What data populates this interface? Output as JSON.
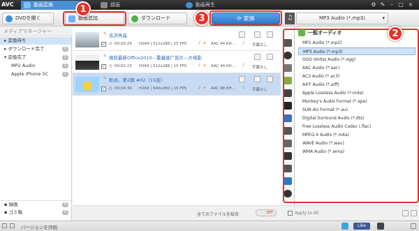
{
  "app": {
    "logo": "AVC"
  },
  "tabs": [
    {
      "label": "動画変換"
    },
    {
      "label": "録画"
    },
    {
      "label": "動画再生"
    }
  ],
  "toolbar": {
    "dvd_label": "DVDを開く",
    "add_video_label": "動画追加",
    "download_label": "ダウンロード",
    "convert_label": "変換",
    "format_select": "MP3 Audio (*.mp3)"
  },
  "badges": {
    "one": "1",
    "two": "2",
    "three": "3"
  },
  "sidebar": {
    "header": "メディアマネージャー",
    "items": [
      {
        "label": "変換待ち",
        "count": ""
      },
      {
        "label": "ダウンロード完了",
        "count": "0"
      },
      {
        "label": "変換完了",
        "count": "2"
      },
      {
        "label": "MP2 Audio",
        "count": "1"
      },
      {
        "label": "Apple iPhone 5C",
        "count": "1"
      }
    ],
    "bottom_items": [
      {
        "label": "録画",
        "count": "0"
      },
      {
        "label": "ゴミ箱",
        "count": "0"
      }
    ]
  },
  "files": [
    {
      "name": "吉沢亮晶",
      "duration": "00:00:29",
      "video": "H264 | 512x288 | 15 FPS",
      "audio": "AAC 44 KH...",
      "subtitle": "字幕なし"
    },
    {
      "name": "微软最新Office2010—重量级广告片—大电影",
      "duration": "00:02:15",
      "video": "H264 | 512x288 | 15 FPS",
      "audio": "AAC 44 KH...",
      "subtitle": "字幕なし"
    },
    {
      "name": "乾貞。第2期 #02（15話）",
      "duration": "00:04:30",
      "video": "H264 | 640x360 | 15 FPS",
      "audio": "AAC 48 KH...",
      "subtitle": "字幕なし"
    }
  ],
  "list_footer": {
    "merge_label": "全てのファイルを結合",
    "toggle": "OFF"
  },
  "format_panel": {
    "category": "一般オーディオ",
    "items": [
      "MP2 Audio (*.mp2)",
      "MP3 Audio (*.mp3)",
      "OGG Vorbis Audio (*.ogg)",
      "AAC Audio (*.aac)",
      "AC3 Audio (*.ac3)",
      "AIFF Audio (*.aiff)",
      "Apple Lossless Audio (*.m4a)",
      "Monkey's Audio Format (*.ape)",
      "SUN AU Format (*.au)",
      "Digital Surround Audio (*.dts)",
      "Free Lossless Audio Codec (.flac)",
      "MPEG-4 Audio (*.m4a)",
      "WAVE Audio (*.wav)",
      "WMA Audio (*.wma)"
    ],
    "selected_index": 1,
    "apply_all": "Apply to All"
  },
  "statusbar": {
    "rate_label": "バージョンを評価",
    "like": "Like"
  },
  "colors": {
    "accent": "#2f78c8",
    "highlight": "#e8302a"
  }
}
